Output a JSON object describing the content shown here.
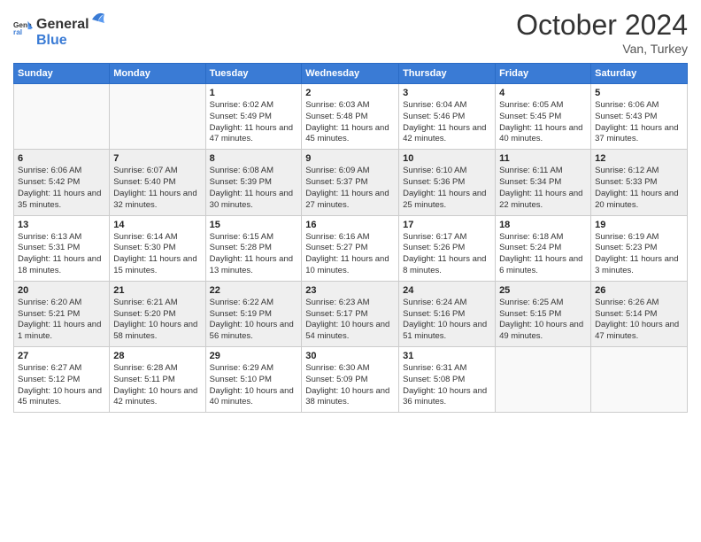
{
  "header": {
    "logo_general": "General",
    "logo_blue": "Blue",
    "month": "October 2024",
    "location": "Van, Turkey"
  },
  "days_of_week": [
    "Sunday",
    "Monday",
    "Tuesday",
    "Wednesday",
    "Thursday",
    "Friday",
    "Saturday"
  ],
  "weeks": [
    [
      {
        "day": "",
        "info": ""
      },
      {
        "day": "",
        "info": ""
      },
      {
        "day": "1",
        "info": "Sunrise: 6:02 AM\nSunset: 5:49 PM\nDaylight: 11 hours and 47 minutes."
      },
      {
        "day": "2",
        "info": "Sunrise: 6:03 AM\nSunset: 5:48 PM\nDaylight: 11 hours and 45 minutes."
      },
      {
        "day": "3",
        "info": "Sunrise: 6:04 AM\nSunset: 5:46 PM\nDaylight: 11 hours and 42 minutes."
      },
      {
        "day": "4",
        "info": "Sunrise: 6:05 AM\nSunset: 5:45 PM\nDaylight: 11 hours and 40 minutes."
      },
      {
        "day": "5",
        "info": "Sunrise: 6:06 AM\nSunset: 5:43 PM\nDaylight: 11 hours and 37 minutes."
      }
    ],
    [
      {
        "day": "6",
        "info": "Sunrise: 6:06 AM\nSunset: 5:42 PM\nDaylight: 11 hours and 35 minutes."
      },
      {
        "day": "7",
        "info": "Sunrise: 6:07 AM\nSunset: 5:40 PM\nDaylight: 11 hours and 32 minutes."
      },
      {
        "day": "8",
        "info": "Sunrise: 6:08 AM\nSunset: 5:39 PM\nDaylight: 11 hours and 30 minutes."
      },
      {
        "day": "9",
        "info": "Sunrise: 6:09 AM\nSunset: 5:37 PM\nDaylight: 11 hours and 27 minutes."
      },
      {
        "day": "10",
        "info": "Sunrise: 6:10 AM\nSunset: 5:36 PM\nDaylight: 11 hours and 25 minutes."
      },
      {
        "day": "11",
        "info": "Sunrise: 6:11 AM\nSunset: 5:34 PM\nDaylight: 11 hours and 22 minutes."
      },
      {
        "day": "12",
        "info": "Sunrise: 6:12 AM\nSunset: 5:33 PM\nDaylight: 11 hours and 20 minutes."
      }
    ],
    [
      {
        "day": "13",
        "info": "Sunrise: 6:13 AM\nSunset: 5:31 PM\nDaylight: 11 hours and 18 minutes."
      },
      {
        "day": "14",
        "info": "Sunrise: 6:14 AM\nSunset: 5:30 PM\nDaylight: 11 hours and 15 minutes."
      },
      {
        "day": "15",
        "info": "Sunrise: 6:15 AM\nSunset: 5:28 PM\nDaylight: 11 hours and 13 minutes."
      },
      {
        "day": "16",
        "info": "Sunrise: 6:16 AM\nSunset: 5:27 PM\nDaylight: 11 hours and 10 minutes."
      },
      {
        "day": "17",
        "info": "Sunrise: 6:17 AM\nSunset: 5:26 PM\nDaylight: 11 hours and 8 minutes."
      },
      {
        "day": "18",
        "info": "Sunrise: 6:18 AM\nSunset: 5:24 PM\nDaylight: 11 hours and 6 minutes."
      },
      {
        "day": "19",
        "info": "Sunrise: 6:19 AM\nSunset: 5:23 PM\nDaylight: 11 hours and 3 minutes."
      }
    ],
    [
      {
        "day": "20",
        "info": "Sunrise: 6:20 AM\nSunset: 5:21 PM\nDaylight: 11 hours and 1 minute."
      },
      {
        "day": "21",
        "info": "Sunrise: 6:21 AM\nSunset: 5:20 PM\nDaylight: 10 hours and 58 minutes."
      },
      {
        "day": "22",
        "info": "Sunrise: 6:22 AM\nSunset: 5:19 PM\nDaylight: 10 hours and 56 minutes."
      },
      {
        "day": "23",
        "info": "Sunrise: 6:23 AM\nSunset: 5:17 PM\nDaylight: 10 hours and 54 minutes."
      },
      {
        "day": "24",
        "info": "Sunrise: 6:24 AM\nSunset: 5:16 PM\nDaylight: 10 hours and 51 minutes."
      },
      {
        "day": "25",
        "info": "Sunrise: 6:25 AM\nSunset: 5:15 PM\nDaylight: 10 hours and 49 minutes."
      },
      {
        "day": "26",
        "info": "Sunrise: 6:26 AM\nSunset: 5:14 PM\nDaylight: 10 hours and 47 minutes."
      }
    ],
    [
      {
        "day": "27",
        "info": "Sunrise: 6:27 AM\nSunset: 5:12 PM\nDaylight: 10 hours and 45 minutes."
      },
      {
        "day": "28",
        "info": "Sunrise: 6:28 AM\nSunset: 5:11 PM\nDaylight: 10 hours and 42 minutes."
      },
      {
        "day": "29",
        "info": "Sunrise: 6:29 AM\nSunset: 5:10 PM\nDaylight: 10 hours and 40 minutes."
      },
      {
        "day": "30",
        "info": "Sunrise: 6:30 AM\nSunset: 5:09 PM\nDaylight: 10 hours and 38 minutes."
      },
      {
        "day": "31",
        "info": "Sunrise: 6:31 AM\nSunset: 5:08 PM\nDaylight: 10 hours and 36 minutes."
      },
      {
        "day": "",
        "info": ""
      },
      {
        "day": "",
        "info": ""
      }
    ]
  ]
}
